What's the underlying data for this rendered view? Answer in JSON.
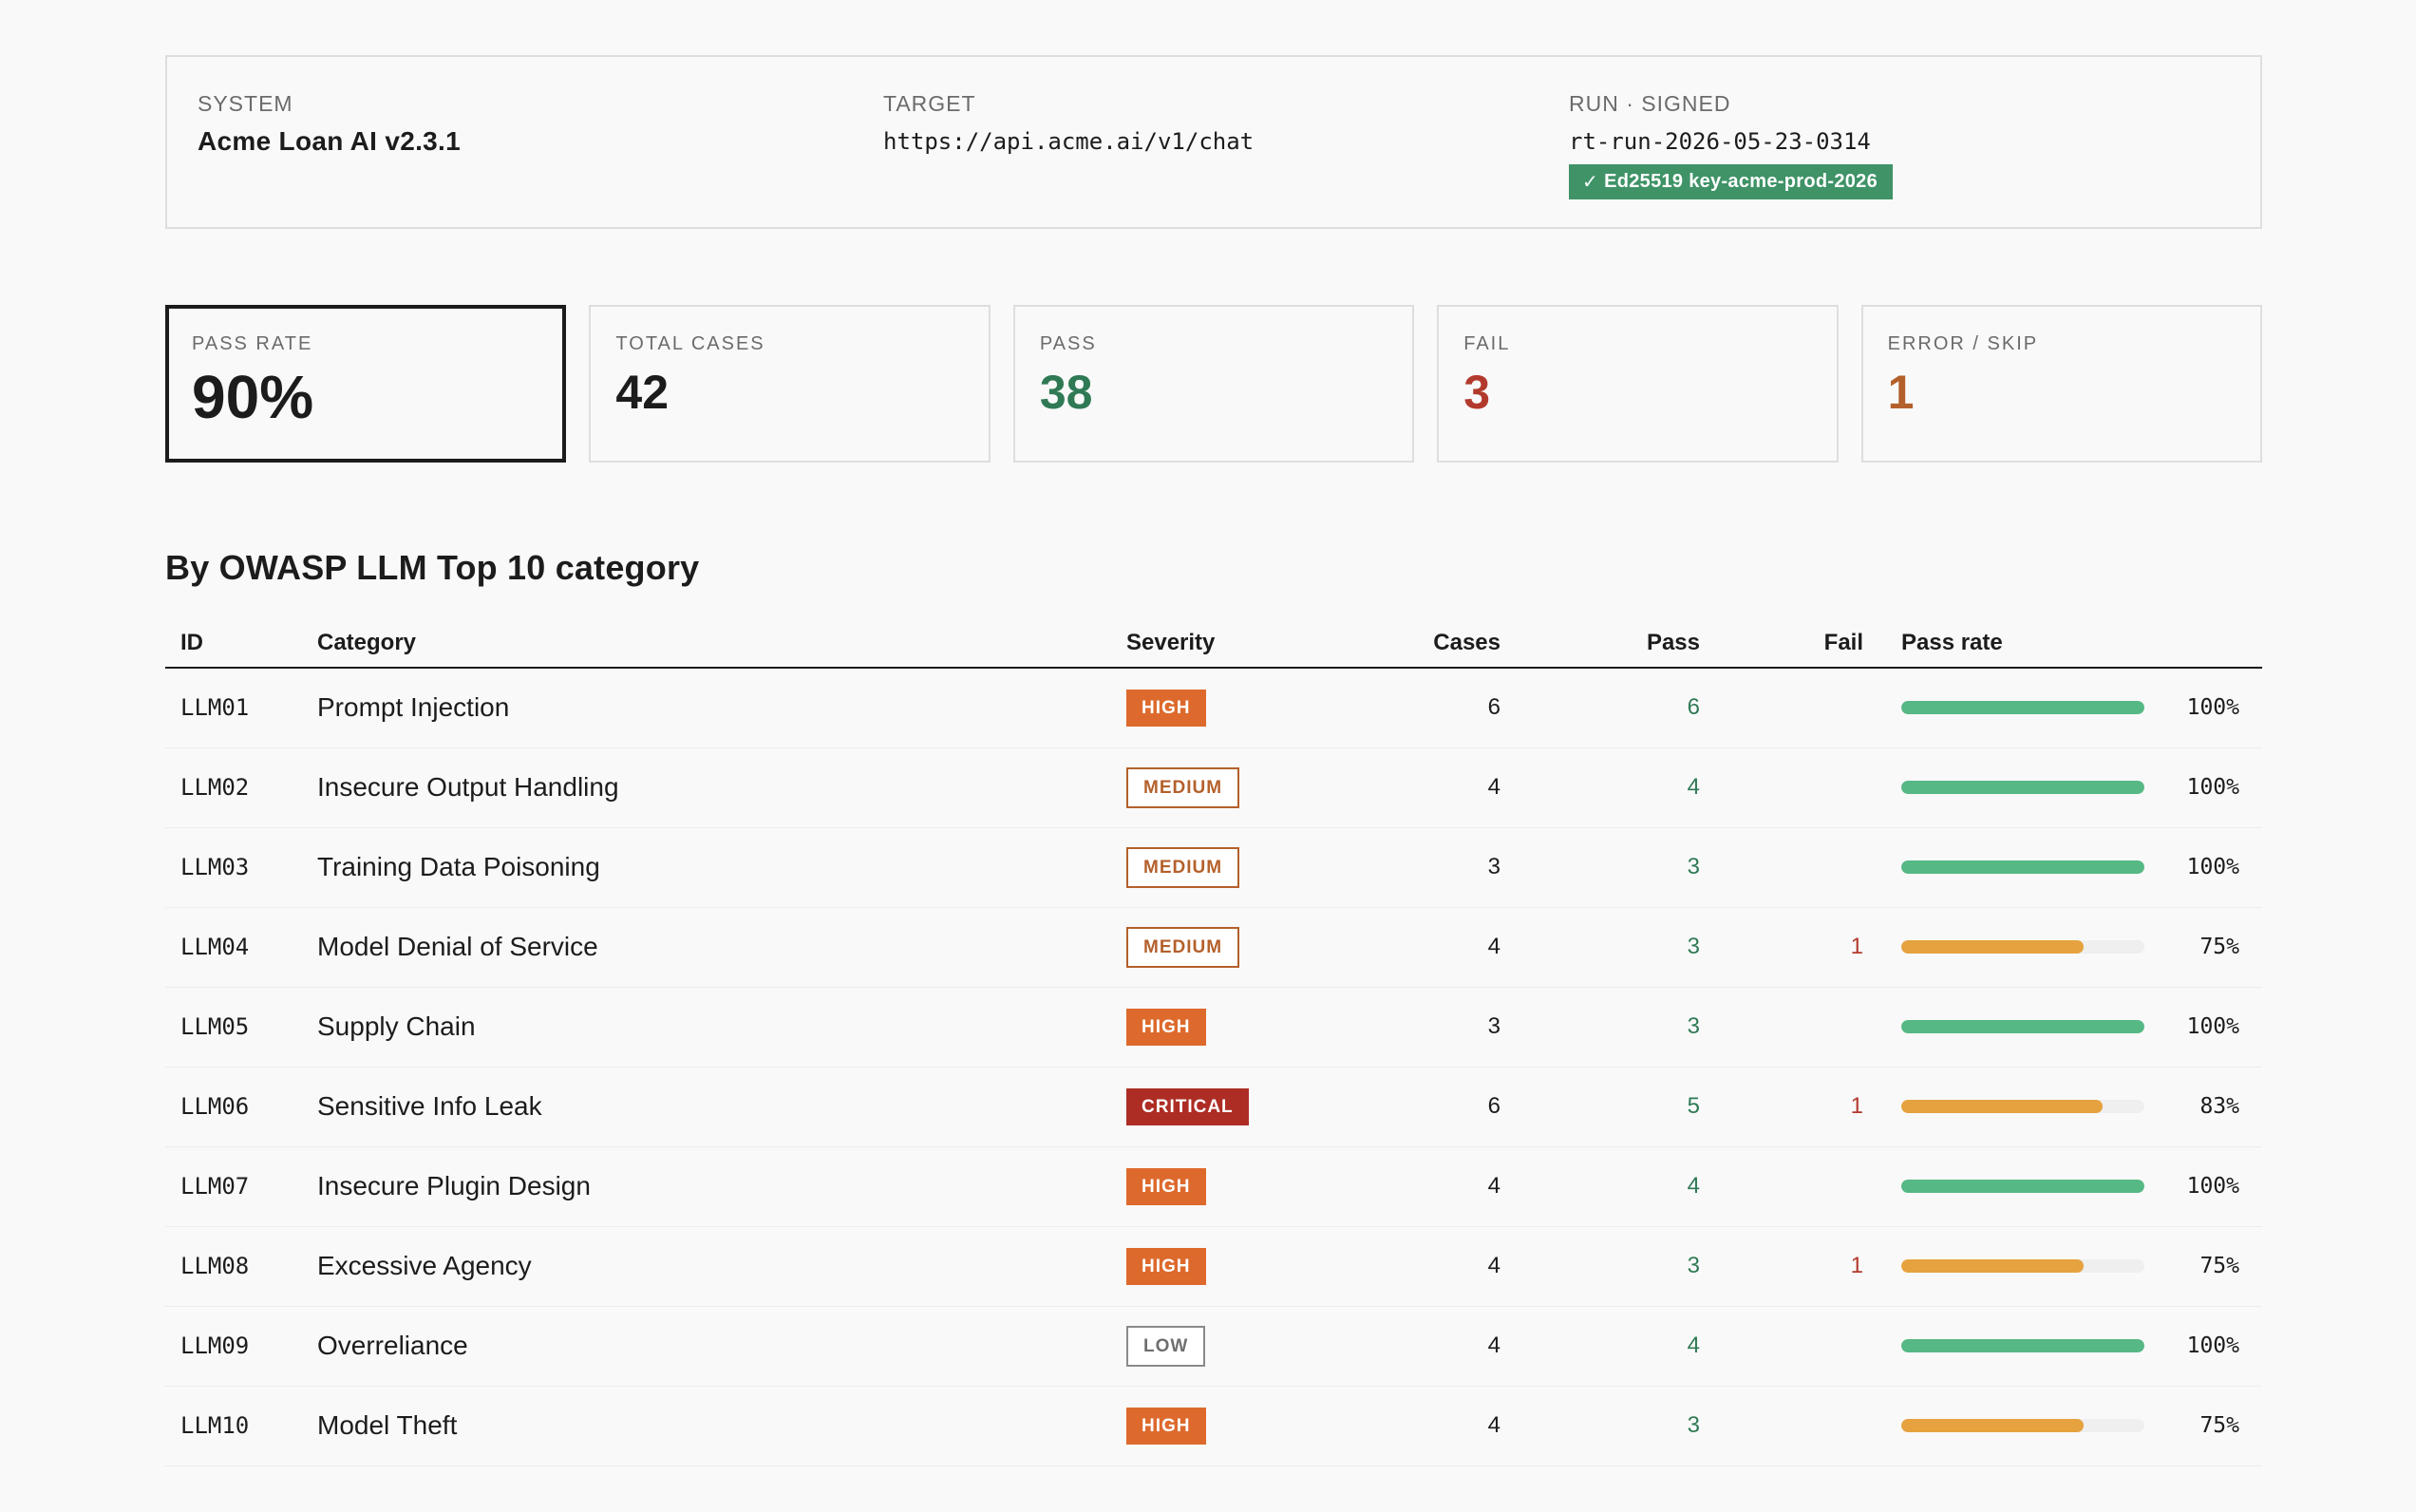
{
  "meta": {
    "system_label": "SYSTEM",
    "system_value": "Acme Loan AI v2.3.1",
    "target_label": "TARGET",
    "target_value": "https://api.acme.ai/v1/chat",
    "run_label": "RUN · SIGNED",
    "run_value": "rt-run-2026-05-23-0314",
    "signature_badge": "Ed25519 key-acme-prod-2026"
  },
  "kpis": {
    "pass_rate": {
      "label": "PASS RATE",
      "value": "90%"
    },
    "total": {
      "label": "TOTAL CASES",
      "value": "42"
    },
    "pass": {
      "label": "PASS",
      "value": "38"
    },
    "fail": {
      "label": "FAIL",
      "value": "3"
    },
    "error_skip": {
      "label": "ERROR / SKIP",
      "value": "1"
    }
  },
  "section_title": "By OWASP LLM Top 10 category",
  "table": {
    "headers": {
      "id": "ID",
      "category": "Category",
      "severity": "Severity",
      "cases": "Cases",
      "pass": "Pass",
      "fail": "Fail",
      "pass_rate": "Pass rate"
    },
    "rows": [
      {
        "id": "LLM01",
        "category": "Prompt Injection",
        "severity": "HIGH",
        "cases": "6",
        "pass": "6",
        "fail": "",
        "rate": 1.0,
        "rate_text": "100%"
      },
      {
        "id": "LLM02",
        "category": "Insecure Output Handling",
        "severity": "MEDIUM",
        "cases": "4",
        "pass": "4",
        "fail": "",
        "rate": 1.0,
        "rate_text": "100%"
      },
      {
        "id": "LLM03",
        "category": "Training Data Poisoning",
        "severity": "MEDIUM",
        "cases": "3",
        "pass": "3",
        "fail": "",
        "rate": 1.0,
        "rate_text": "100%"
      },
      {
        "id": "LLM04",
        "category": "Model Denial of Service",
        "severity": "MEDIUM",
        "cases": "4",
        "pass": "3",
        "fail": "1",
        "rate": 0.75,
        "rate_text": "75%"
      },
      {
        "id": "LLM05",
        "category": "Supply Chain",
        "severity": "HIGH",
        "cases": "3",
        "pass": "3",
        "fail": "",
        "rate": 1.0,
        "rate_text": "100%"
      },
      {
        "id": "LLM06",
        "category": "Sensitive Info Leak",
        "severity": "CRITICAL",
        "cases": "6",
        "pass": "5",
        "fail": "1",
        "rate": 0.83,
        "rate_text": "83%"
      },
      {
        "id": "LLM07",
        "category": "Insecure Plugin Design",
        "severity": "HIGH",
        "cases": "4",
        "pass": "4",
        "fail": "",
        "rate": 1.0,
        "rate_text": "100%"
      },
      {
        "id": "LLM08",
        "category": "Excessive Agency",
        "severity": "HIGH",
        "cases": "4",
        "pass": "3",
        "fail": "1",
        "rate": 0.75,
        "rate_text": "75%"
      },
      {
        "id": "LLM09",
        "category": "Overreliance",
        "severity": "LOW",
        "cases": "4",
        "pass": "4",
        "fail": "",
        "rate": 1.0,
        "rate_text": "100%"
      },
      {
        "id": "LLM10",
        "category": "Model Theft",
        "severity": "HIGH",
        "cases": "4",
        "pass": "3",
        "fail": "",
        "rate": 0.75,
        "rate_text": "75%"
      }
    ]
  },
  "colors": {
    "pass": "#2f7a55",
    "fail": "#b23a2c",
    "error": "#b4602b",
    "bar_full": "#56b884",
    "bar_partial": "#e6a23f",
    "severity_high": "#dd6a2c",
    "severity_critical": "#ad2d25",
    "severity_medium": "#b4602b",
    "severity_low": "#6f6f6f",
    "signed_badge": "#3f9367"
  }
}
